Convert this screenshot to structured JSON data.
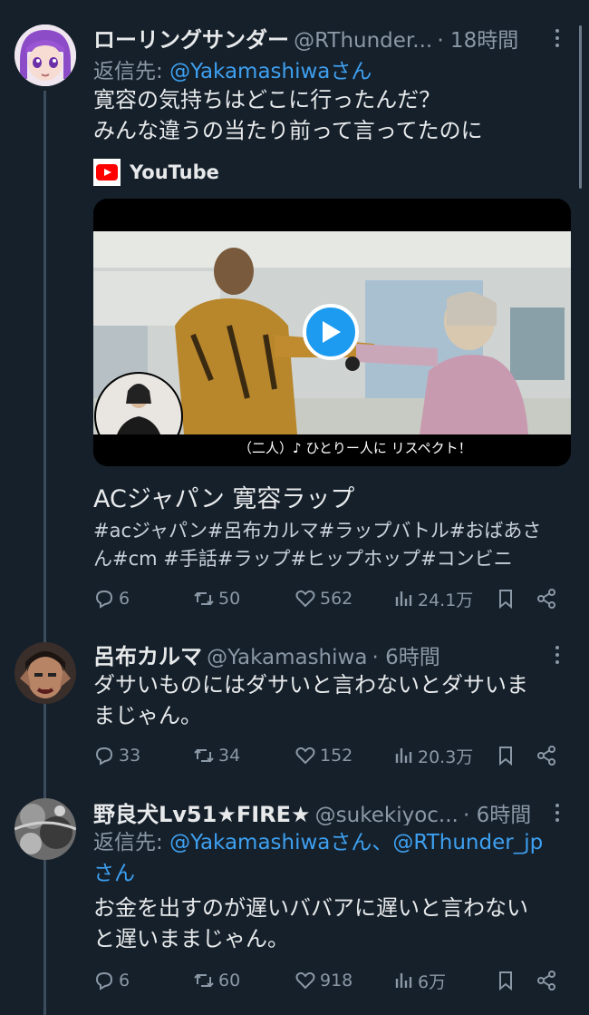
{
  "tweets": [
    {
      "name": "ローリングサンダー",
      "handle": "@RThunder...",
      "time": "· 18時間",
      "reply_prefix": "返信先:",
      "reply_to": "@Yakamashiwaさん",
      "text_lines": [
        "寛容の気持ちはどこに行ったんだ？",
        "みんな違うの当たり前って言ってたのに"
      ],
      "stats": {
        "replies": "6",
        "retweets": "50",
        "likes": "562",
        "views": "24.1万"
      }
    },
    {
      "name": "呂布カルマ",
      "handle": "@Yakamashiwa",
      "time": "· 6時間",
      "text_lines": [
        "ダサいものにはダサいと言わないとダサいま",
        "まじゃん。"
      ],
      "stats": {
        "replies": "33",
        "retweets": "34",
        "likes": "152",
        "views": "20.3万"
      }
    },
    {
      "name": "野良犬Lv51★FIRE★",
      "handle": "@sukekiyoc...",
      "time": "· 6時間",
      "reply_prefix": "返信先:",
      "reply_to_1": "@Yakamashiwaさん、@RThunder_jp",
      "reply_to_2": "さん",
      "text_lines": [
        "お金を出すのが遅いババアに遅いと言わない",
        "と遅いままじゃん。"
      ],
      "stats": {
        "replies": "6",
        "retweets": "60",
        "likes": "918",
        "views": "6万"
      }
    }
  ],
  "card": {
    "source": "YouTube",
    "caption": "（二人）♪ ひとりー人に リスペクト！",
    "title": "ACジャパン 寛容ラップ",
    "desc_lines": [
      "#acジャパン#呂布カルマ#ラップバトル#おばあさ",
      "ん#cm #手話#ラップ#ヒップホップ#コンビニ"
    ]
  },
  "colors": {
    "background": "#15202b",
    "accent": "#3ea0f0",
    "muted": "#8b98a5"
  },
  "icons": [
    "reply-icon",
    "retweet-icon",
    "like-icon",
    "views-icon",
    "bookmark-icon",
    "share-icon",
    "play-icon",
    "youtube-logo-icon"
  ]
}
